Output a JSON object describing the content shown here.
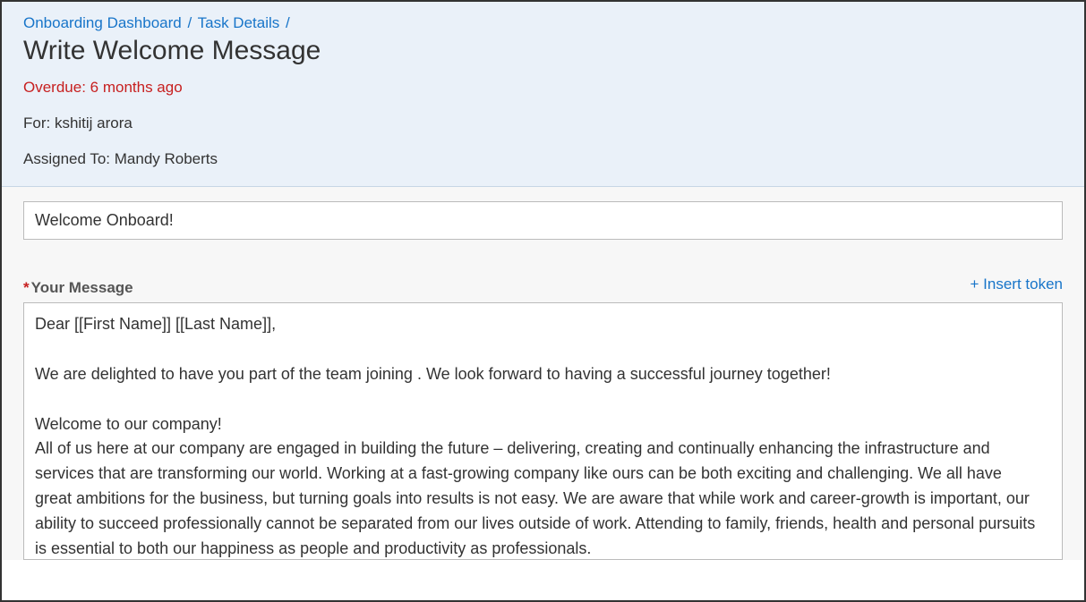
{
  "breadcrumb": {
    "item1": "Onboarding Dashboard",
    "sep1": "/",
    "item2": "Task Details",
    "sep2": "/"
  },
  "page_title": "Write Welcome Message",
  "overdue_text": "Overdue: 6 months ago",
  "for_label": "For: kshitij arora",
  "assigned_label": "Assigned To: Mandy Roberts",
  "subject_value": "Welcome Onboard!",
  "message_label": "Your Message",
  "required_asterisk": "*",
  "insert_token_label": "+ Insert token",
  "message_value": "Dear [[First Name]] [[Last Name]],\n\nWe are delighted to have you part of the team joining . We look forward to having a successful journey together!\n\nWelcome to our company!\nAll of us here at our company are engaged in building the future – delivering, creating and continually enhancing the infrastructure and services that are transforming our world. Working at a fast-growing company like ours can be both exciting and challenging. We all have great ambitions for the business, but turning goals into results is not easy. We are aware that while work and career-growth is important, our ability to succeed professionally cannot be separated from our lives outside of work. Attending to family, friends, health and personal pursuits is essential to both our happiness as people and productivity as professionals.\n\nWe look forward to working with you.\n\nBest regards,\nThe Team"
}
